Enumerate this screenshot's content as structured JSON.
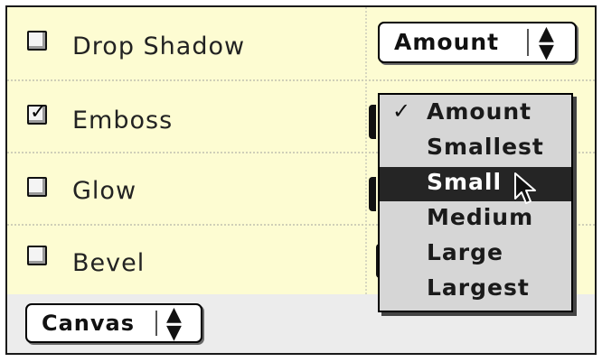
{
  "effects": [
    {
      "label": "Drop Shadow",
      "checked": false
    },
    {
      "label": "Emboss",
      "checked": true
    },
    {
      "label": "Glow",
      "checked": false
    },
    {
      "label": "Bevel",
      "checked": false
    }
  ],
  "check_glyph": "✓",
  "amount_popup": {
    "selected": "Amount",
    "arrows_glyph": "⬍"
  },
  "amount_menu": {
    "items": [
      "Amount",
      "Smallest",
      "Small",
      "Medium",
      "Large",
      "Largest"
    ],
    "checked_item": "Amount",
    "highlighted_item": "Small"
  },
  "canvas_popup": {
    "label": "Canvas",
    "arrows_glyph": "⬍"
  },
  "colors": {
    "grid_background": "#fdfcd2",
    "panel_background": "#ececec",
    "menu_background": "#d6d6d6",
    "highlight": "#252525"
  }
}
